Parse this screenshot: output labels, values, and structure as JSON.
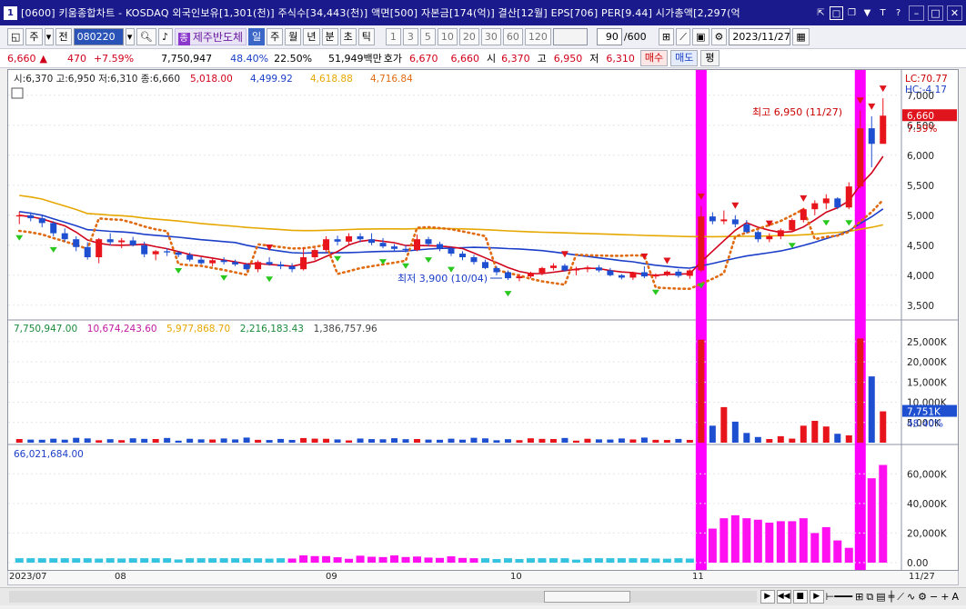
{
  "title_bar": {
    "window_number": "1",
    "title": "[0600] 키움종합차트 - KOSDAQ 외국인보유[1,301(천)] 주식수[34,443(천)] 액면[500] 자본금[174(억)] 결산[12월] EPS[706] PER[9.44] 시가총액[2,297(억"
  },
  "toolbar": {
    "period_select": "주",
    "prev_label": "전",
    "code": "080220",
    "stock_tag": "종",
    "stock_name": "제주반도체",
    "periods": [
      "일",
      "주",
      "월",
      "년",
      "분",
      "초",
      "틱"
    ],
    "selected_period": "일",
    "minute_options": [
      "1",
      "3",
      "5",
      "10",
      "20",
      "30",
      "60",
      "120"
    ],
    "count": "90",
    "count_total": "/600",
    "date": "2023/11/27"
  },
  "quote": {
    "price": "6,660",
    "change": "470",
    "change_pct": "+7.59%",
    "volume": "7,750,947",
    "volume_pct": "48.40%",
    "turnover": "22.50%",
    "amount": "51,949백만",
    "hoga_label": "호가",
    "hoga_ask": "6,670",
    "hoga_bid": "6,660",
    "open_label": "시",
    "open": "6,370",
    "high_label": "고",
    "high": "6,950",
    "low_label": "저",
    "low": "6,310",
    "buy_label": "매수",
    "sell_label": "매도",
    "flat_label": "평"
  },
  "price_panel": {
    "ohlc_legend": "시:6,370 고:6,950 저:6,310 종:6,660",
    "ma_values": [
      "5,018.00",
      "4,499.92",
      "4,618.88",
      "4,716.84"
    ],
    "ma_colors": [
      "#d0021b",
      "#1b3fc8",
      "#e6a800",
      "#e06a10"
    ],
    "lc": "LC:70.77",
    "hc": "HC:-4.17",
    "max_label": "최고 6,950 (11/27)",
    "min_label": "최저 3,900 (10/04)",
    "last_price": "6,660",
    "last_pct": "7.59%",
    "y_ticks": [
      "7,000",
      "6,500",
      "6,000",
      "5,500",
      "5,000",
      "4,500",
      "4,000",
      "3,500"
    ]
  },
  "volume_panel": {
    "legend": [
      "7,750,947.00",
      "10,674,243.60",
      "5,977,868.70",
      "2,216,183.43",
      "1,386,757.96"
    ],
    "legend_colors": [
      "#1a8a3a",
      "#c01aa0",
      "#e6a800",
      "#1a8a3a",
      "#444444"
    ],
    "last_value": "7,751K",
    "last_pct": "48.40%",
    "y_ticks": [
      "25,000K",
      "20,000K",
      "15,000K",
      "10,000K",
      "5,000K"
    ]
  },
  "amount_panel": {
    "legend": "66,021,684.00",
    "y_ticks": [
      "60,000K",
      "40,000K",
      "20,000K",
      "0.00"
    ]
  },
  "x_axis": {
    "labels": [
      "2023/07",
      "08",
      "09",
      "10",
      "11",
      "11/27"
    ]
  },
  "chart_data": {
    "type": "candlestick",
    "series": [
      {
        "name": "price",
        "ohlc": [
          [
            4980,
            5060,
            4850,
            5000
          ],
          [
            5000,
            5050,
            4900,
            4950
          ],
          [
            4950,
            5000,
            4800,
            4870
          ],
          [
            4870,
            4900,
            4650,
            4700
          ],
          [
            4700,
            4780,
            4560,
            4600
          ],
          [
            4600,
            4650,
            4400,
            4470
          ],
          [
            4470,
            4550,
            4260,
            4300
          ],
          [
            4300,
            4620,
            4200,
            4600
          ],
          [
            4600,
            4700,
            4500,
            4550
          ],
          [
            4550,
            4620,
            4450,
            4580
          ],
          [
            4580,
            4640,
            4480,
            4500
          ],
          [
            4500,
            4560,
            4300,
            4350
          ],
          [
            4350,
            4420,
            4250,
            4400
          ],
          [
            4400,
            4450,
            4320,
            4380
          ],
          [
            4380,
            4400,
            4300,
            4340
          ],
          [
            4340,
            4380,
            4230,
            4260
          ],
          [
            4260,
            4300,
            4180,
            4200
          ],
          [
            4200,
            4280,
            4150,
            4250
          ],
          [
            4250,
            4300,
            4180,
            4220
          ],
          [
            4220,
            4260,
            4150,
            4180
          ],
          [
            4180,
            4200,
            4080,
            4100
          ],
          [
            4100,
            4250,
            4050,
            4220
          ],
          [
            4220,
            4300,
            4160,
            4180
          ],
          [
            4180,
            4230,
            4100,
            4150
          ],
          [
            4150,
            4200,
            4050,
            4100
          ],
          [
            4100,
            4460,
            4080,
            4300
          ],
          [
            4300,
            4450,
            4250,
            4420
          ],
          [
            4420,
            4650,
            4380,
            4600
          ],
          [
            4600,
            4660,
            4500,
            4560
          ],
          [
            4560,
            4700,
            4520,
            4650
          ],
          [
            4650,
            4700,
            4550,
            4600
          ],
          [
            4600,
            4700,
            4500,
            4540
          ],
          [
            4540,
            4620,
            4450,
            4480
          ],
          [
            4480,
            4520,
            4400,
            4440
          ],
          [
            4440,
            4500,
            4380,
            4420
          ],
          [
            4420,
            4680,
            4400,
            4600
          ],
          [
            4600,
            4640,
            4480,
            4520
          ],
          [
            4520,
            4560,
            4400,
            4450
          ],
          [
            4450,
            4480,
            4320,
            4360
          ],
          [
            4360,
            4400,
            4250,
            4300
          ],
          [
            4300,
            4340,
            4180,
            4220
          ],
          [
            4220,
            4260,
            4100,
            4120
          ],
          [
            4120,
            4150,
            4000,
            4050
          ],
          [
            4050,
            4080,
            3920,
            3950
          ],
          [
            3950,
            4020,
            3900,
            3980
          ],
          [
            3980,
            4060,
            3950,
            4040
          ],
          [
            4040,
            4140,
            4000,
            4120
          ],
          [
            4120,
            4200,
            4080,
            4160
          ],
          [
            4160,
            4190,
            4060,
            4080
          ],
          [
            4080,
            4140,
            4000,
            4100
          ],
          [
            4100,
            4160,
            4050,
            4130
          ],
          [
            4130,
            4170,
            4050,
            4080
          ],
          [
            4080,
            4120,
            3980,
            4000
          ],
          [
            4000,
            4020,
            3930,
            3960
          ],
          [
            3960,
            4060,
            3920,
            4050
          ],
          [
            4050,
            4150,
            3950,
            3980
          ],
          [
            3980,
            4030,
            3940,
            4010
          ],
          [
            4010,
            4080,
            3980,
            4060
          ],
          [
            4060,
            4100,
            3960,
            3990
          ],
          [
            3990,
            4100,
            3940,
            4080
          ],
          [
            4080,
            5150,
            4050,
            4980
          ],
          [
            4980,
            5050,
            4850,
            4900
          ],
          [
            4900,
            5080,
            4850,
            4930
          ],
          [
            4930,
            5000,
            4800,
            4850
          ],
          [
            4850,
            4920,
            4700,
            4720
          ],
          [
            4720,
            4750,
            4550,
            4600
          ],
          [
            4600,
            4700,
            4550,
            4650
          ],
          [
            4650,
            4780,
            4600,
            4750
          ],
          [
            4750,
            4950,
            4720,
            4920
          ],
          [
            4920,
            5120,
            4880,
            5100
          ],
          [
            5100,
            5250,
            5000,
            5200
          ],
          [
            5200,
            5350,
            5100,
            5280
          ],
          [
            5280,
            5300,
            5100,
            5130
          ],
          [
            5130,
            5550,
            5100,
            5480
          ],
          [
            5480,
            6750,
            5450,
            6450
          ],
          [
            6450,
            6650,
            5800,
            6190
          ],
          [
            6190,
            6950,
            6310,
            6660
          ]
        ]
      }
    ],
    "annotations": {
      "high": {
        "value": 6950,
        "date": "11/27"
      },
      "low": {
        "value": 3900,
        "date": "10/04"
      }
    },
    "ylim": [
      3300,
      7300
    ]
  }
}
